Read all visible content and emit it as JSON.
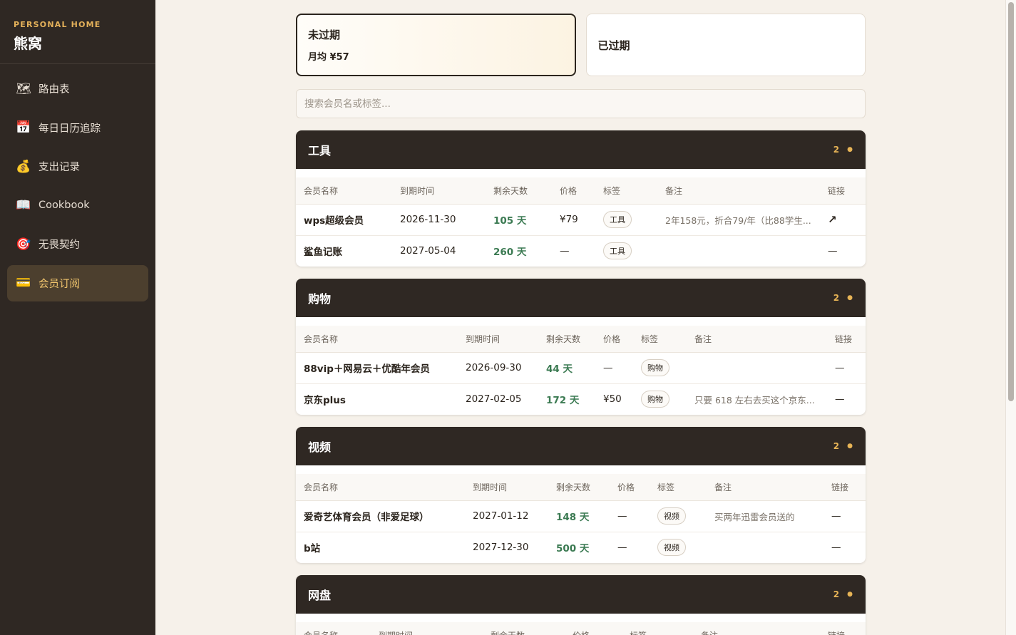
{
  "brand": {
    "sub": "PERSONAL HOME",
    "title": "熊窝"
  },
  "nav": [
    {
      "icon": "🗺",
      "icon_name": "map-icon",
      "label": "路由表"
    },
    {
      "icon": "📅",
      "icon_name": "calendar-icon",
      "label": "每日日历追踪"
    },
    {
      "icon": "💰",
      "icon_name": "money-bag-icon",
      "label": "支出记录"
    },
    {
      "icon": "📖",
      "icon_name": "book-icon",
      "label": "Cookbook"
    },
    {
      "icon": "🎯",
      "icon_name": "target-icon",
      "label": "无畏契约"
    },
    {
      "icon": "💳",
      "icon_name": "credit-card-icon",
      "label": "会员订阅"
    }
  ],
  "status": {
    "active": {
      "title": "未过期",
      "sub": "月均 ¥57"
    },
    "expired": {
      "title": "已过期"
    }
  },
  "search": {
    "placeholder": "搜索会员名或标签..."
  },
  "columns": [
    "会员名称",
    "到期时间",
    "剩余天数",
    "价格",
    "标签",
    "备注",
    "链接"
  ],
  "sections": [
    {
      "title": "工具",
      "count": "2",
      "rows": [
        {
          "name": "wps超级会员",
          "date": "2026-11-30",
          "days": "105 天",
          "price": "¥79",
          "tag": "工具",
          "note": "2年158元，折合79/年（比88学生...",
          "link": "↗"
        },
        {
          "name": "鲨鱼记账",
          "date": "2027-05-04",
          "days": "260 天",
          "price": "—",
          "tag": "工具",
          "note": "",
          "link": "—"
        }
      ]
    },
    {
      "title": "购物",
      "count": "2",
      "rows": [
        {
          "name": "88vip＋网易云＋优酷年会员",
          "date": "2026-09-30",
          "days": "44 天",
          "price": "—",
          "tag": "购物",
          "note": "",
          "link": "—"
        },
        {
          "name": "京东plus",
          "date": "2027-02-05",
          "days": "172 天",
          "price": "¥50",
          "tag": "购物",
          "note": "只要 618 左右去买这个京东...",
          "link": "—"
        }
      ]
    },
    {
      "title": "视频",
      "count": "2",
      "rows": [
        {
          "name": "爱奇艺体育会员（非爱足球）",
          "date": "2027-01-12",
          "days": "148 天",
          "price": "—",
          "tag": "视频",
          "note": "买两年迅雷会员送的",
          "link": "—"
        },
        {
          "name": "b站",
          "date": "2027-12-30",
          "days": "500 天",
          "price": "—",
          "tag": "视频",
          "note": "",
          "link": "—"
        }
      ]
    },
    {
      "title": "网盘",
      "count": "2",
      "rows": []
    }
  ],
  "colors": {
    "sidebar": "#2f2823",
    "accent": "#e7b456",
    "days_green": "#3b7a52"
  }
}
